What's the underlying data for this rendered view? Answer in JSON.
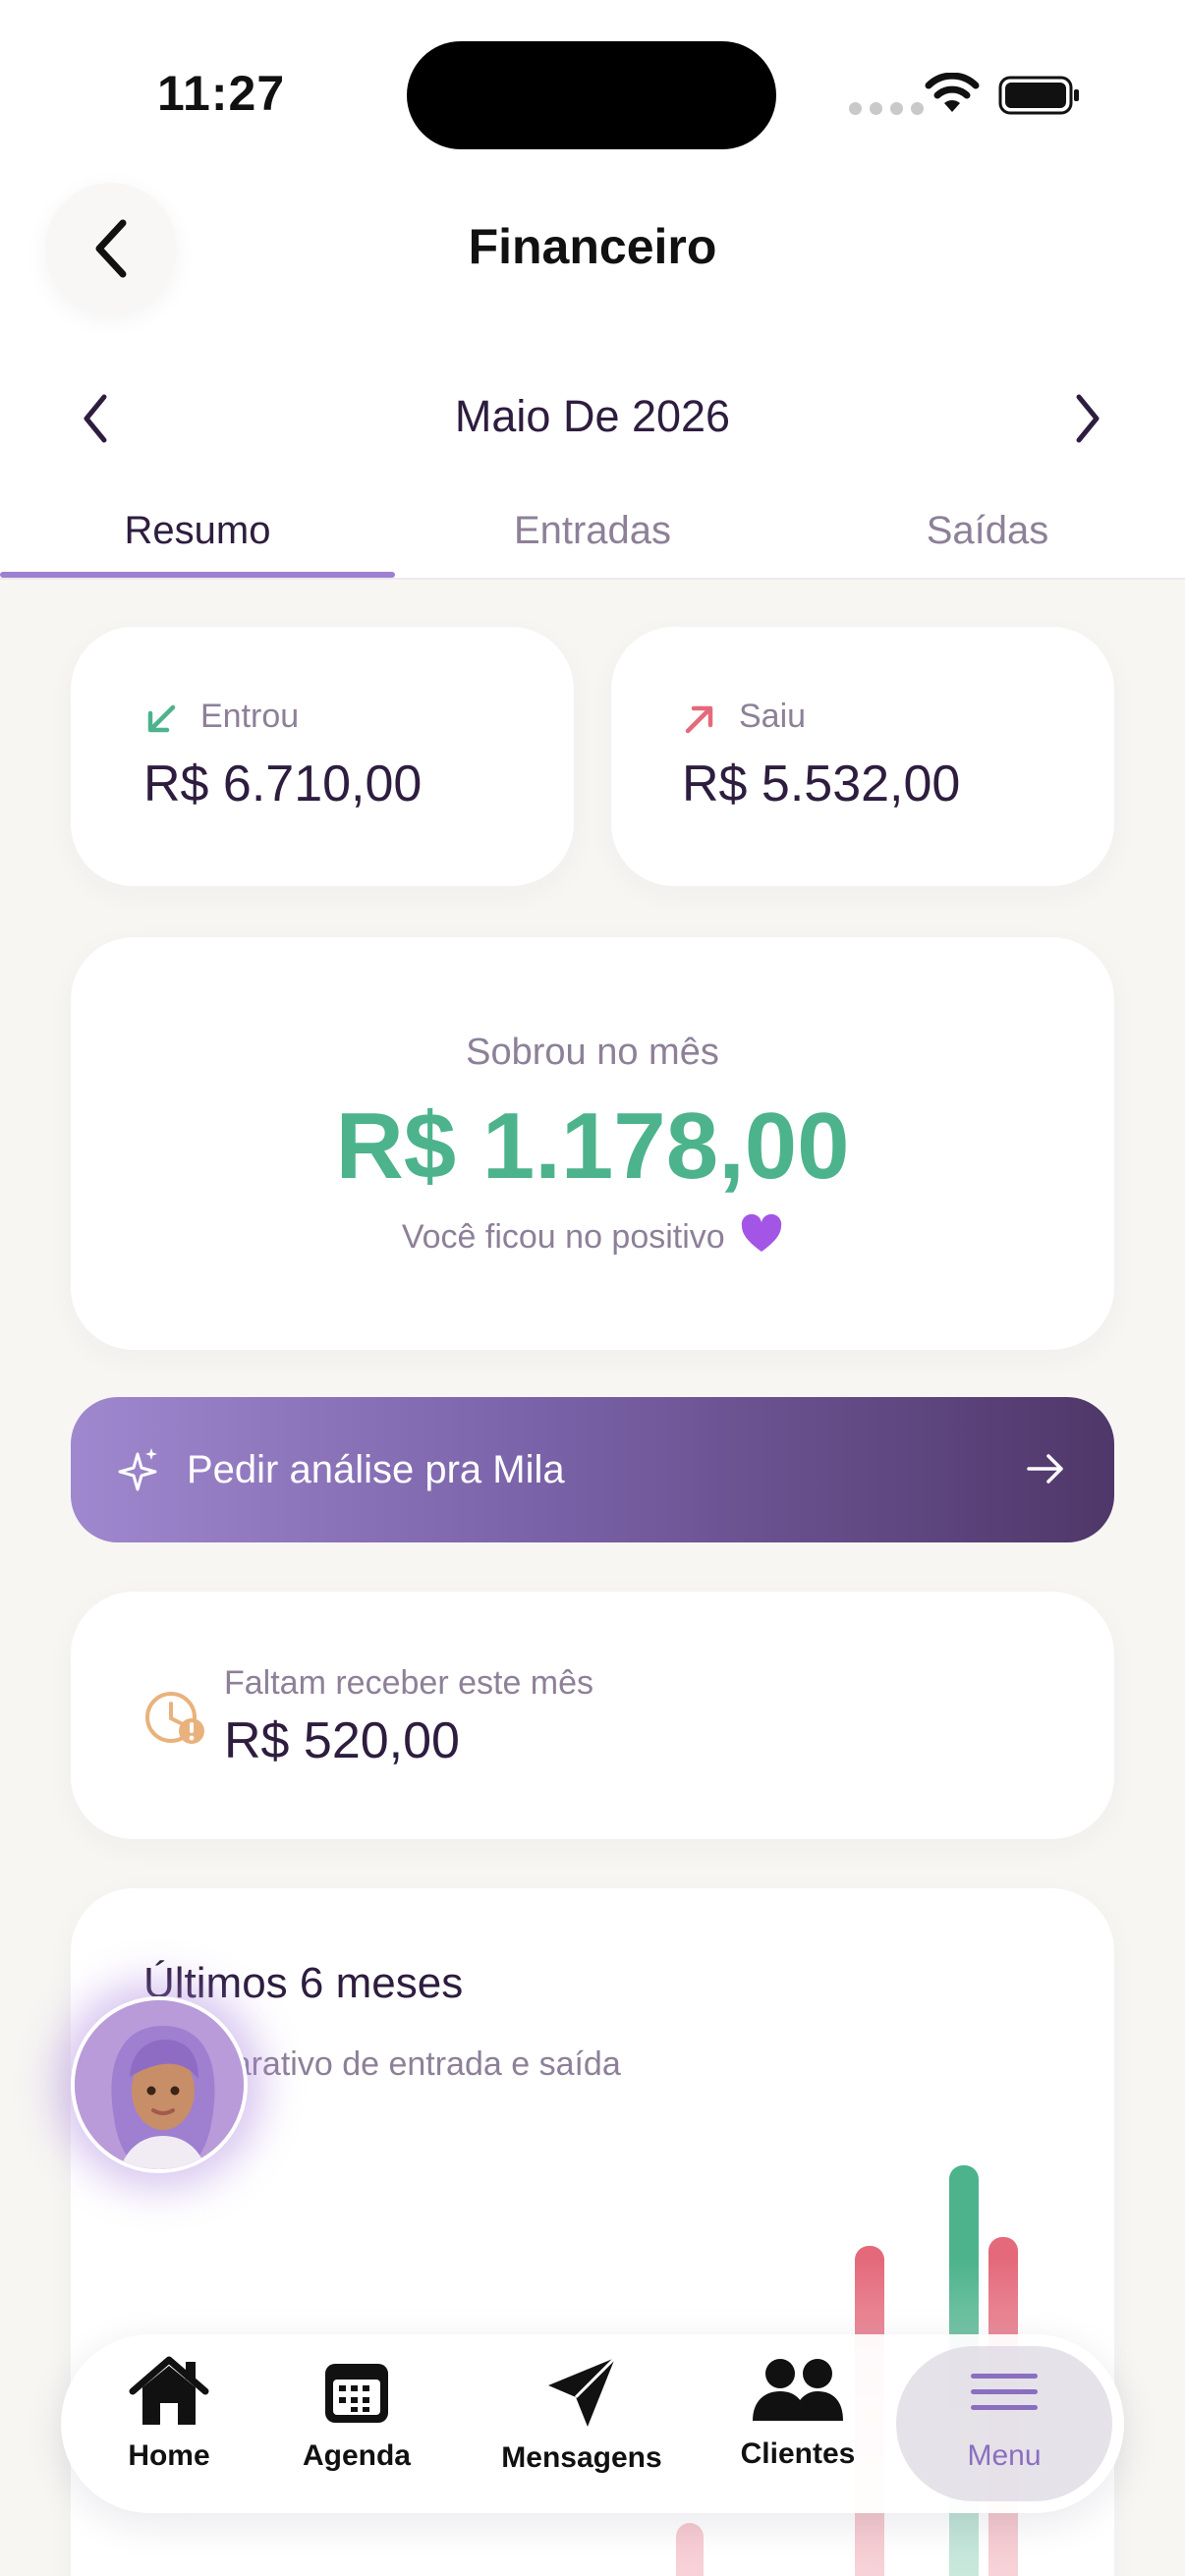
{
  "status": {
    "time": "11:27"
  },
  "header": {
    "title": "Financeiro",
    "month": "Maio De 2026"
  },
  "tabs": [
    {
      "label": "Resumo",
      "active": true
    },
    {
      "label": "Entradas",
      "active": false
    },
    {
      "label": "Saídas",
      "active": false
    }
  ],
  "summary": {
    "in_label": "Entrou",
    "in_value": "R$ 6.710,00",
    "out_label": "Saiu",
    "out_value": "R$ 5.532,00",
    "balance_label": "Sobrou no mês",
    "balance_value": "R$ 1.178,00",
    "balance_note": "Você ficou no positivo"
  },
  "ai_button": {
    "label": "Pedir análise pra Mila"
  },
  "pending": {
    "label": "Faltam receber este mês",
    "value": "R$ 520,00"
  },
  "chart": {
    "title": "Últimos 6 meses",
    "subtitle": "Comparativo de entrada e saída"
  },
  "chart_data": {
    "type": "bar",
    "categories": [
      "",
      "",
      "",
      "",
      "",
      ""
    ],
    "series": [
      {
        "values": [
          0,
          0,
          0,
          0,
          0,
          6710
        ]
      },
      {
        "values": [
          0,
          0,
          0,
          0,
          5400,
          5532
        ]
      }
    ]
  },
  "nav": [
    {
      "label": "Home",
      "icon": "home-icon"
    },
    {
      "label": "Agenda",
      "icon": "calendar-icon"
    },
    {
      "label": "Mensagens",
      "icon": "send-icon"
    },
    {
      "label": "Clientes",
      "icon": "users-icon"
    },
    {
      "label": "Menu",
      "icon": "menu-icon",
      "active": true
    }
  ],
  "colors": {
    "accent": "#9d80cf",
    "positive": "#4db38d",
    "negative": "#e46a7b",
    "text": "#2e1d3f",
    "muted": "#8d8098"
  }
}
